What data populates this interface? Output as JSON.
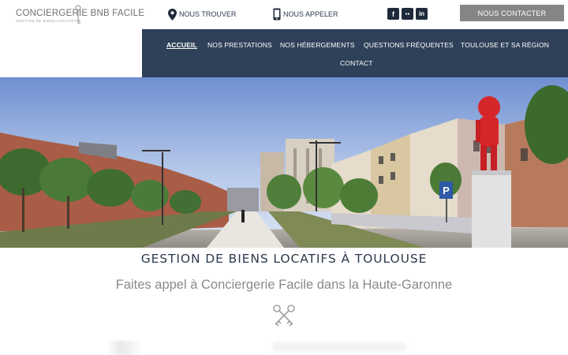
{
  "header": {
    "logo_text": "CONCIERGERIE BNB FACILE",
    "logo_tagline": "GESTION DE BIENS LOCATIFS",
    "find_label": "NOUS TROUVER",
    "call_label": "NOUS APPELER",
    "contact_button": "NOUS CONTACTER",
    "socials": [
      {
        "name": "facebook",
        "glyph": "f"
      },
      {
        "name": "tripadvisor",
        "glyph": "●●"
      },
      {
        "name": "linkedin",
        "glyph": "in"
      }
    ]
  },
  "nav": {
    "items": [
      {
        "label": "ACCUEIL",
        "active": true
      },
      {
        "label": "NOS PRESTATIONS"
      },
      {
        "label": "NOS HÉBERGEMENTS"
      },
      {
        "label": "QUESTIONS FRÉQUENTES"
      },
      {
        "label": "TOULOUSE ET SA RÉGION"
      },
      {
        "label": "CONTACT"
      }
    ]
  },
  "hero": {
    "parking_sign": "P"
  },
  "main": {
    "headline": "GESTION DE BIENS LOCATIFS À TOULOUSE",
    "subline": "Faites appel à Conciergerie Facile dans la Haute-Garonne"
  },
  "colors": {
    "nav_bg": "#2f4159",
    "text_dark": "#2c3a4d",
    "button_grey": "#858585",
    "accent_red": "#d6262a"
  }
}
